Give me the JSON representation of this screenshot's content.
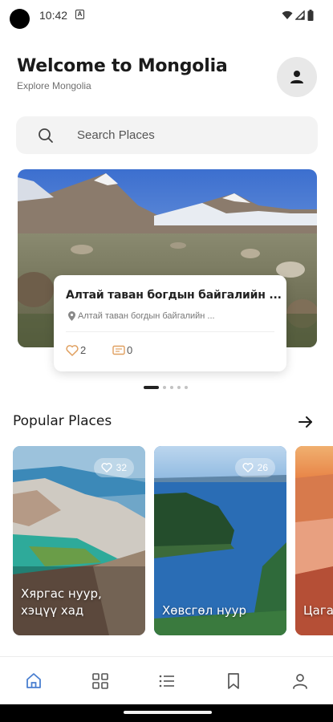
{
  "status_bar": {
    "time": "10:42",
    "app_icon_letter": "A",
    "icons": [
      "wifi-icon",
      "signal-icon",
      "battery-icon"
    ]
  },
  "header": {
    "title": "Welcome to Mongolia",
    "subtitle": "Explore Mongolia",
    "profile_icon": "person-icon"
  },
  "search": {
    "placeholder": "Search Places",
    "icon": "search-icon"
  },
  "featured": {
    "title": "Алтай таван богдын байгалийн ...",
    "location": "Алтай таван богдын байгалийн ...",
    "likes": "2",
    "comments": "0",
    "carousel_pages": 5,
    "active_page": 1
  },
  "popular": {
    "title": "Popular Places",
    "places": [
      {
        "name_line1": "Хяргас нуур,",
        "name_line2": "хэцүү хад",
        "likes": "32"
      },
      {
        "name_line1": "Хөвсгөл нуур",
        "name_line2": "",
        "likes": "26"
      },
      {
        "name_line1": "Цага",
        "name_line2": "",
        "likes": ""
      }
    ]
  },
  "nav": {
    "items": [
      "home-icon",
      "grid-icon",
      "list-icon",
      "bookmark-icon",
      "profile-icon"
    ],
    "active": "home-icon"
  },
  "colors": {
    "accent": "#4a7fd0",
    "like": "#e0a060",
    "text": "#1a1a1a"
  }
}
